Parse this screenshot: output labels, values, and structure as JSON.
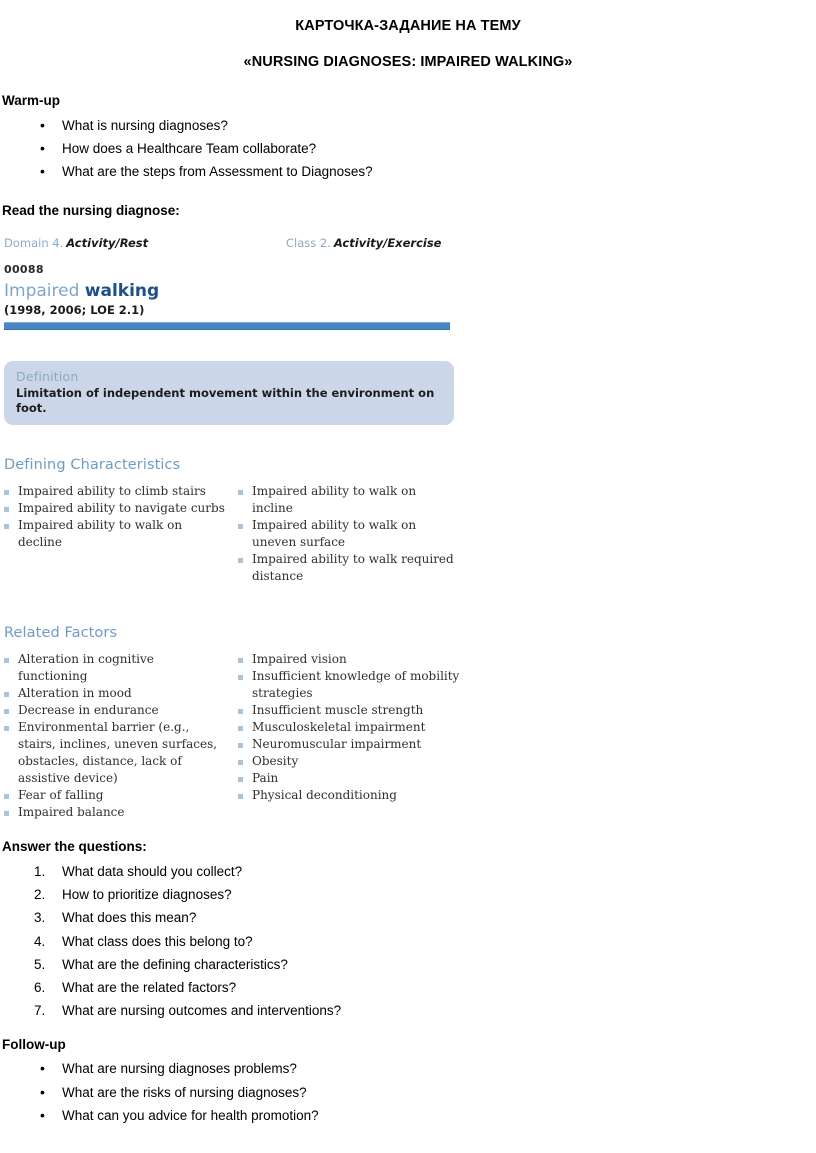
{
  "document": {
    "title_line1": "КАРТОЧКА-ЗАДАНИЕ НА ТЕМУ",
    "title_line2": "«NURSING DIAGNOSES: IMPAIRED WALKING»"
  },
  "warmup": {
    "heading": "Warm-up",
    "items": [
      "What is nursing diagnoses?",
      "How does a Healthcare Team collaborate?",
      "What are the steps from Assessment to Diagnoses?"
    ]
  },
  "read_section": {
    "heading": "Read the nursing diagnose:"
  },
  "nanda_card": {
    "domain_label": "Domain 4.",
    "domain_value": "Activity/Rest",
    "class_label": "Class 2.",
    "class_value": "Activity/Exercise",
    "code": "00088",
    "label_light": "Impaired",
    "label_bold": "walking",
    "years": "(1998, 2006; LOE 2.1)",
    "definition_title": "Definition",
    "definition_text": "Limitation of independent movement within the environment on foot.",
    "defining_characteristics": {
      "title": "Defining Characteristics",
      "left": [
        "Impaired ability to climb stairs",
        "Impaired ability to navigate curbs",
        "Impaired ability to walk on decline"
      ],
      "right": [
        "Impaired ability to walk on incline",
        "Impaired ability to walk on uneven surface",
        "Impaired ability to walk required distance"
      ]
    },
    "related_factors": {
      "title": "Related Factors",
      "left": [
        "Alteration in cognitive functioning",
        "Alteration in mood",
        "Decrease in endurance",
        "Environmental barrier (e.g., stairs, inclines, uneven surfaces, obstacles, distance, lack of assistive device)",
        "Fear of falling",
        "Impaired balance"
      ],
      "right": [
        "Impaired vision",
        "Insufficient knowledge of mobility strategies",
        "Insufficient muscle strength",
        "Musculoskeletal impairment",
        "Neuromuscular impairment",
        "Obesity",
        "Pain",
        "Physical deconditioning"
      ]
    },
    "colors": {
      "rule_blue": "#4a85c4",
      "definition_bg": "#ccd6e9",
      "section_title": "#6f9bc6",
      "label_bold_blue": "#1e4f86",
      "label_light_blue": "#7ea6cc",
      "bullet_square": "#aac3dc"
    }
  },
  "answer_section": {
    "heading": "Answer the questions:",
    "items": [
      "What data should you collect?",
      "How to prioritize diagnoses?",
      "What does this mean?",
      "What class does this belong to?",
      "What are the defining characteristics?",
      "What are the related factors?",
      "What are nursing outcomes and interventions?"
    ]
  },
  "followup": {
    "heading": "Follow-up",
    "items": [
      "What are nursing diagnoses problems?",
      "What are the risks of nursing diagnoses?",
      "What can you advice for health promotion?"
    ]
  }
}
